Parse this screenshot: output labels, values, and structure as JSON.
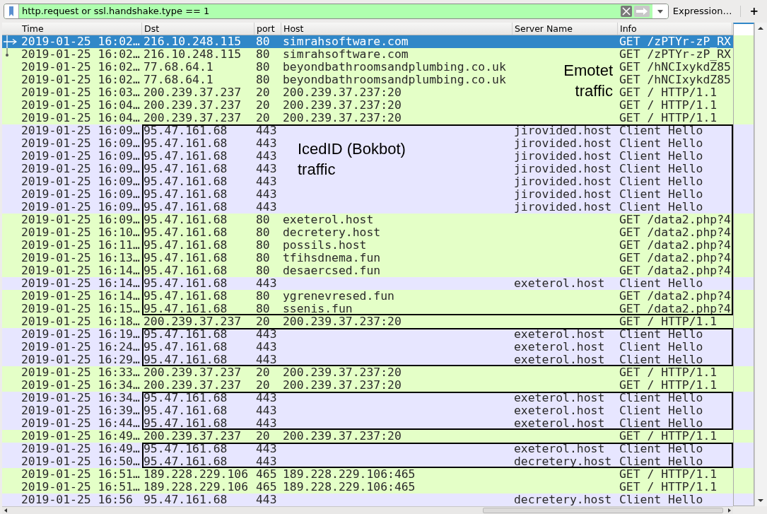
{
  "filter_bar": {
    "value": "http.request or ssl.handshake.type == 1",
    "expression_button": "Expression…",
    "add_button": "+"
  },
  "packet_list": {
    "columns": [
      "Time",
      "Dst",
      "port",
      "Host",
      "Server Name",
      "Info"
    ],
    "rows": [
      {
        "time": "2019-01-25 16:02…",
        "dst": "216.10.248.115",
        "port": "80",
        "host": "simrahsoftware.com",
        "info": "GET /zPTYr-zP_RX",
        "color": "#e4ffc7",
        "selected": true,
        "outlined": false,
        "kind": "request"
      },
      {
        "time": "2019-01-25 16:02…",
        "dst": "216.10.248.115",
        "port": "80",
        "host": "simrahsoftware.com",
        "info": "GET /zPTYr-zP_RX",
        "color": "#e4ffc7",
        "selected": false,
        "outlined": false,
        "kind": "response"
      },
      {
        "time": "2019-01-25 16:02…",
        "dst": "77.68.64.1",
        "port": "80",
        "host": "beyondbathroomsandplumbing.co.uk",
        "info": "GET /hNCIxykdZ85",
        "color": "#e4ffc7",
        "selected": false,
        "outlined": false,
        "kind": "plain"
      },
      {
        "time": "2019-01-25 16:02…",
        "dst": "77.68.64.1",
        "port": "80",
        "host": "beyondbathroomsandplumbing.co.uk",
        "info": "GET /hNCIxykdZ85",
        "color": "#e4ffc7",
        "selected": false,
        "outlined": false,
        "kind": "plain"
      },
      {
        "time": "2019-01-25 16:03…",
        "dst": "200.239.37.237",
        "port": "20",
        "host": "200.239.37.237:20",
        "info": "GET / HTTP/1.1",
        "color": "#e4ffc7",
        "selected": false,
        "outlined": false,
        "kind": "plain"
      },
      {
        "time": "2019-01-25 16:04…",
        "dst": "200.239.37.237",
        "port": "20",
        "host": "200.239.37.237:20",
        "info": "GET / HTTP/1.1",
        "color": "#e4ffc7",
        "selected": false,
        "outlined": false,
        "kind": "plain"
      },
      {
        "time": "2019-01-25 16:04…",
        "dst": "200.239.37.237",
        "port": "20",
        "host": "200.239.37.237:20",
        "info": "GET / HTTP/1.1",
        "color": "#e4ffc7",
        "selected": false,
        "outlined": false,
        "kind": "plain"
      },
      {
        "time": "2019-01-25 16:09…",
        "dst": "95.47.161.68",
        "port": "443",
        "server_name": "jirovided.host",
        "info": "Client Hello",
        "color": "#e7e6ff",
        "selected": false,
        "outlined": true,
        "kind": "plain"
      },
      {
        "time": "2019-01-25 16:09…",
        "dst": "95.47.161.68",
        "port": "443",
        "server_name": "jirovided.host",
        "info": "Client Hello",
        "color": "#e7e6ff",
        "selected": false,
        "outlined": true,
        "kind": "plain"
      },
      {
        "time": "2019-01-25 16:09…",
        "dst": "95.47.161.68",
        "port": "443",
        "server_name": "jirovided.host",
        "info": "Client Hello",
        "color": "#e7e6ff",
        "selected": false,
        "outlined": true,
        "kind": "plain"
      },
      {
        "time": "2019-01-25 16:09…",
        "dst": "95.47.161.68",
        "port": "443",
        "server_name": "jirovided.host",
        "info": "Client Hello",
        "color": "#e7e6ff",
        "selected": false,
        "outlined": true,
        "kind": "plain"
      },
      {
        "time": "2019-01-25 16:09…",
        "dst": "95.47.161.68",
        "port": "443",
        "server_name": "jirovided.host",
        "info": "Client Hello",
        "color": "#e7e6ff",
        "selected": false,
        "outlined": true,
        "kind": "plain"
      },
      {
        "time": "2019-01-25 16:09…",
        "dst": "95.47.161.68",
        "port": "443",
        "server_name": "jirovided.host",
        "info": "Client Hello",
        "color": "#e7e6ff",
        "selected": false,
        "outlined": true,
        "kind": "plain"
      },
      {
        "time": "2019-01-25 16:09…",
        "dst": "95.47.161.68",
        "port": "443",
        "server_name": "jirovided.host",
        "info": "Client Hello",
        "color": "#e7e6ff",
        "selected": false,
        "outlined": true,
        "kind": "plain"
      },
      {
        "time": "2019-01-25 16:09…",
        "dst": "95.47.161.68",
        "port": "80",
        "host": "exeterol.host",
        "info": "GET /data2.php?4",
        "color": "#e4ffc7",
        "selected": false,
        "outlined": true,
        "kind": "plain"
      },
      {
        "time": "2019-01-25 16:10…",
        "dst": "95.47.161.68",
        "port": "80",
        "host": "decretery.host",
        "info": "GET /data2.php?4",
        "color": "#e4ffc7",
        "selected": false,
        "outlined": true,
        "kind": "plain"
      },
      {
        "time": "2019-01-25 16:11…",
        "dst": "95.47.161.68",
        "port": "80",
        "host": "possils.host",
        "info": "GET /data2.php?4",
        "color": "#e4ffc7",
        "selected": false,
        "outlined": true,
        "kind": "plain"
      },
      {
        "time": "2019-01-25 16:13…",
        "dst": "95.47.161.68",
        "port": "80",
        "host": "tfihsdnema.fun",
        "info": "GET /data2.php?4",
        "color": "#e4ffc7",
        "selected": false,
        "outlined": true,
        "kind": "plain"
      },
      {
        "time": "2019-01-25 16:14…",
        "dst": "95.47.161.68",
        "port": "80",
        "host": "desaercsed.fun",
        "info": "GET /data2.php?4",
        "color": "#e4ffc7",
        "selected": false,
        "outlined": true,
        "kind": "plain"
      },
      {
        "time": "2019-01-25 16:14…",
        "dst": "95.47.161.68",
        "port": "443",
        "server_name": "exeterol.host",
        "info": "Client Hello",
        "color": "#e7e6ff",
        "selected": false,
        "outlined": true,
        "kind": "plain"
      },
      {
        "time": "2019-01-25 16:14…",
        "dst": "95.47.161.68",
        "port": "80",
        "host": "ygrenevresed.fun",
        "info": "GET /data2.php?4",
        "color": "#e4ffc7",
        "selected": false,
        "outlined": true,
        "kind": "plain"
      },
      {
        "time": "2019-01-25 16:15…",
        "dst": "95.47.161.68",
        "port": "80",
        "host": "ssenis.fun",
        "info": "GET /data2.php?4",
        "color": "#e4ffc7",
        "selected": false,
        "outlined": true,
        "kind": "plain"
      },
      {
        "time": "2019-01-25 16:18…",
        "dst": "200.239.37.237",
        "port": "20",
        "host": "200.239.37.237:20",
        "info": "GET / HTTP/1.1",
        "color": "#e4ffc7",
        "selected": false,
        "outlined": false,
        "kind": "plain"
      },
      {
        "time": "2019-01-25 16:19…",
        "dst": "95.47.161.68",
        "port": "443",
        "server_name": "exeterol.host",
        "info": "Client Hello",
        "color": "#e7e6ff",
        "selected": false,
        "outlined": true,
        "kind": "plain"
      },
      {
        "time": "2019-01-25 16:24…",
        "dst": "95.47.161.68",
        "port": "443",
        "server_name": "exeterol.host",
        "info": "Client Hello",
        "color": "#e7e6ff",
        "selected": false,
        "outlined": true,
        "kind": "plain"
      },
      {
        "time": "2019-01-25 16:29…",
        "dst": "95.47.161.68",
        "port": "443",
        "server_name": "exeterol.host",
        "info": "Client Hello",
        "color": "#e7e6ff",
        "selected": false,
        "outlined": true,
        "kind": "plain"
      },
      {
        "time": "2019-01-25 16:33…",
        "dst": "200.239.37.237",
        "port": "20",
        "host": "200.239.37.237:20",
        "info": "GET / HTTP/1.1",
        "color": "#e4ffc7",
        "selected": false,
        "outlined": false,
        "kind": "plain"
      },
      {
        "time": "2019-01-25 16:34…",
        "dst": "200.239.37.237",
        "port": "20",
        "host": "200.239.37.237:20",
        "info": "GET / HTTP/1.1",
        "color": "#e4ffc7",
        "selected": false,
        "outlined": false,
        "kind": "plain"
      },
      {
        "time": "2019-01-25 16:34…",
        "dst": "95.47.161.68",
        "port": "443",
        "server_name": "exeterol.host",
        "info": "Client Hello",
        "color": "#e7e6ff",
        "selected": false,
        "outlined": true,
        "kind": "plain"
      },
      {
        "time": "2019-01-25 16:39…",
        "dst": "95.47.161.68",
        "port": "443",
        "server_name": "exeterol.host",
        "info": "Client Hello",
        "color": "#e7e6ff",
        "selected": false,
        "outlined": true,
        "kind": "plain"
      },
      {
        "time": "2019-01-25 16:44…",
        "dst": "95.47.161.68",
        "port": "443",
        "server_name": "exeterol.host",
        "info": "Client Hello",
        "color": "#e7e6ff",
        "selected": false,
        "outlined": true,
        "kind": "plain"
      },
      {
        "time": "2019-01-25 16:49…",
        "dst": "200.239.37.237",
        "port": "20",
        "host": "200.239.37.237:20",
        "info": "GET / HTTP/1.1",
        "color": "#e4ffc7",
        "selected": false,
        "outlined": false,
        "kind": "plain"
      },
      {
        "time": "2019-01-25 16:49…",
        "dst": "95.47.161.68",
        "port": "443",
        "server_name": "exeterol.host",
        "info": "Client Hello",
        "color": "#e7e6ff",
        "selected": false,
        "outlined": true,
        "kind": "plain"
      },
      {
        "time": "2019-01-25 16:50…",
        "dst": "95.47.161.68",
        "port": "443",
        "server_name": "decretery.host",
        "info": "Client Hello",
        "color": "#e7e6ff",
        "selected": false,
        "outlined": true,
        "kind": "plain"
      },
      {
        "time": "2019-01-25 16:51…",
        "dst": "189.228.229.106",
        "port": "465",
        "host": "189.228.229.106:465",
        "info": "GET / HTTP/1.1",
        "color": "#e4ffc7",
        "selected": false,
        "outlined": false,
        "kind": "plain"
      },
      {
        "time": "2019-01-25 16:51…",
        "dst": "189.228.229.106",
        "port": "465",
        "host": "189.228.229.106:465",
        "info": "GET / HTTP/1.1",
        "color": "#e4ffc7",
        "selected": false,
        "outlined": false,
        "kind": "plain"
      },
      {
        "time": "2019-01-25 16:56",
        "dst": "95.47.161.68",
        "port": "443",
        "server_name": "decretery.host",
        "info": "Client Hello",
        "color": "#e7e6ff",
        "selected": false,
        "outlined": false,
        "kind": "plain"
      }
    ]
  },
  "annotations": [
    {
      "text": "Emotet traffic"
    },
    {
      "text": "IcedID (Bokbot) traffic"
    }
  ]
}
